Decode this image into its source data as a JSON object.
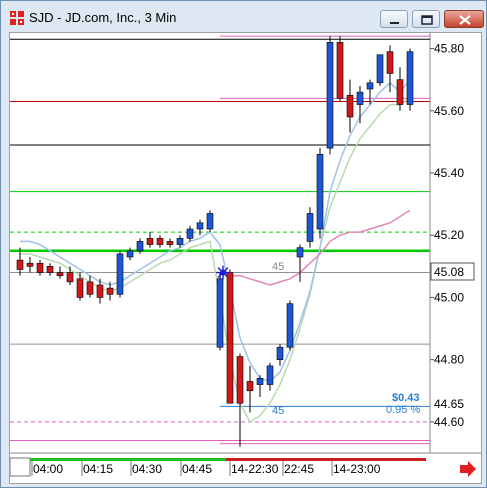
{
  "window": {
    "title": "SJD - JD.com, Inc., 3 Min",
    "app_icon": "grid-app-icon",
    "buttons": [
      "minimize-icon",
      "restore-icon",
      "close-icon"
    ]
  },
  "chart_data": {
    "type": "candlestick",
    "symbol": "SJD",
    "interval": "3 Min",
    "y_ticks": [
      "45.80",
      "45.60",
      "45.40",
      "45.20",
      "45.00",
      "44.80",
      "44.60"
    ],
    "ylim": [
      44.5,
      45.85
    ],
    "x_ticks": [
      "04:00",
      "04:15",
      "04:30",
      "04:45",
      "14-22:30",
      "22:45",
      "14-23:00"
    ],
    "current_price": "45.08",
    "price_tag": "44.65",
    "change_label": "$0.43",
    "change_pct": "0.95 %",
    "line_label_upper": "45",
    "line_label_lower": "45",
    "colors": {
      "up": "#1e57d6",
      "down": "#d01818",
      "ma_fast": "#9ec2ea",
      "ma_slow": "#b9d9b0",
      "ma_pink": "#e487b8",
      "support": "#00cc00",
      "label_blue": "#2a7fd4"
    },
    "candles": [
      {
        "o": 45.12,
        "h": 45.16,
        "l": 45.07,
        "c": 45.09
      },
      {
        "o": 45.11,
        "h": 45.13,
        "l": 45.08,
        "c": 45.1
      },
      {
        "o": 45.11,
        "h": 45.12,
        "l": 45.07,
        "c": 45.08
      },
      {
        "o": 45.1,
        "h": 45.11,
        "l": 45.07,
        "c": 45.08
      },
      {
        "o": 45.08,
        "h": 45.1,
        "l": 45.06,
        "c": 45.07
      },
      {
        "o": 45.08,
        "h": 45.1,
        "l": 45.04,
        "c": 45.05
      },
      {
        "o": 45.06,
        "h": 45.08,
        "l": 44.99,
        "c": 45.0
      },
      {
        "o": 45.05,
        "h": 45.07,
        "l": 45.0,
        "c": 45.01
      },
      {
        "o": 45.04,
        "h": 45.06,
        "l": 44.98,
        "c": 45.0
      },
      {
        "o": 45.03,
        "h": 45.05,
        "l": 44.99,
        "c": 45.01
      },
      {
        "o": 45.01,
        "h": 45.15,
        "l": 45.0,
        "c": 45.14
      },
      {
        "o": 45.13,
        "h": 45.16,
        "l": 45.12,
        "c": 45.15
      },
      {
        "o": 45.15,
        "h": 45.19,
        "l": 45.14,
        "c": 45.18
      },
      {
        "o": 45.19,
        "h": 45.21,
        "l": 45.16,
        "c": 45.17
      },
      {
        "o": 45.19,
        "h": 45.2,
        "l": 45.16,
        "c": 45.17
      },
      {
        "o": 45.18,
        "h": 45.19,
        "l": 45.16,
        "c": 45.17
      },
      {
        "o": 45.17,
        "h": 45.2,
        "l": 45.16,
        "c": 45.19
      },
      {
        "o": 45.19,
        "h": 45.23,
        "l": 45.18,
        "c": 45.22
      },
      {
        "o": 45.22,
        "h": 45.25,
        "l": 45.2,
        "c": 45.24
      },
      {
        "o": 45.22,
        "h": 45.28,
        "l": 45.21,
        "c": 45.27
      },
      {
        "o": 44.84,
        "h": 45.08,
        "l": 44.83,
        "c": 45.06
      },
      {
        "o": 45.08,
        "h": 45.09,
        "l": 44.66,
        "c": 44.66
      },
      {
        "o": 44.81,
        "h": 44.82,
        "l": 44.52,
        "c": 44.66
      },
      {
        "o": 44.73,
        "h": 44.78,
        "l": 44.63,
        "c": 44.7
      },
      {
        "o": 44.72,
        "h": 44.75,
        "l": 44.68,
        "c": 44.74
      },
      {
        "o": 44.72,
        "h": 44.79,
        "l": 44.7,
        "c": 44.78
      },
      {
        "o": 44.8,
        "h": 44.85,
        "l": 44.78,
        "c": 44.84
      },
      {
        "o": 44.84,
        "h": 44.99,
        "l": 44.83,
        "c": 44.98
      },
      {
        "o": 45.13,
        "h": 45.17,
        "l": 45.05,
        "c": 45.16
      },
      {
        "o": 45.18,
        "h": 45.29,
        "l": 45.16,
        "c": 45.27
      },
      {
        "o": 45.22,
        "h": 45.48,
        "l": 45.19,
        "c": 45.46
      },
      {
        "o": 45.48,
        "h": 45.84,
        "l": 45.46,
        "c": 45.82
      },
      {
        "o": 45.82,
        "h": 45.84,
        "l": 45.63,
        "c": 45.64
      },
      {
        "o": 45.65,
        "h": 45.7,
        "l": 45.53,
        "c": 45.58
      },
      {
        "o": 45.62,
        "h": 45.68,
        "l": 45.56,
        "c": 45.66
      },
      {
        "o": 45.67,
        "h": 45.7,
        "l": 45.62,
        "c": 45.69
      },
      {
        "o": 45.69,
        "h": 45.78,
        "l": 45.68,
        "c": 45.78
      },
      {
        "o": 45.79,
        "h": 45.81,
        "l": 45.66,
        "c": 45.72
      },
      {
        "o": 45.7,
        "h": 45.74,
        "l": 45.6,
        "c": 45.62
      },
      {
        "o": 45.62,
        "h": 45.8,
        "l": 45.6,
        "c": 45.79
      }
    ],
    "levels": [
      {
        "y": 45.84,
        "color": "#e060c0",
        "style": "solid",
        "extends_left": false
      },
      {
        "y": 45.83,
        "color": "#000000",
        "style": "solid",
        "extends_left": true
      },
      {
        "y": 45.64,
        "color": "#e060c0",
        "style": "solid",
        "extends_left": false
      },
      {
        "y": 45.63,
        "color": "#c00000",
        "style": "solid",
        "extends_left": true
      },
      {
        "y": 45.49,
        "color": "#000000",
        "style": "solid",
        "extends_left": true
      },
      {
        "y": 45.34,
        "color": "#00cc00",
        "style": "solid",
        "extends_left": true
      },
      {
        "y": 45.21,
        "color": "#00cc00",
        "style": "dashed",
        "extends_left": true
      },
      {
        "y": 45.15,
        "color": "#00cc00",
        "style": "thick",
        "extends_left": true
      },
      {
        "y": 45.08,
        "color": "#909090",
        "style": "solid",
        "extends_left": true
      },
      {
        "y": 44.85,
        "color": "#909090",
        "style": "solid",
        "extends_left": true
      },
      {
        "y": 44.65,
        "color": "#2a7fd4",
        "style": "solid",
        "extends_left": false
      },
      {
        "y": 44.6,
        "color": "#e060c0",
        "style": "dashed",
        "extends_left": true
      },
      {
        "y": 44.54,
        "color": "#e060c0",
        "style": "solid",
        "extends_left": true
      },
      {
        "y": 44.53,
        "color": "#e060c0",
        "style": "solid",
        "extends_left": false
      }
    ],
    "ma_fast": [
      45.18,
      45.18,
      45.17,
      45.15,
      45.13,
      45.11,
      45.09,
      45.07,
      45.05,
      45.04,
      45.05,
      45.07,
      45.09,
      45.11,
      45.13,
      45.15,
      45.16,
      45.18,
      45.19,
      45.21,
      45.17,
      45.03,
      44.87,
      44.79,
      44.74,
      44.73,
      44.76,
      44.83,
      44.92,
      45.02,
      45.16,
      45.34,
      45.44,
      45.52,
      45.58,
      45.62,
      45.66,
      45.69,
      45.66,
      45.7
    ],
    "ma_slow": [
      45.14,
      45.14,
      45.13,
      45.12,
      45.11,
      45.09,
      45.07,
      45.05,
      45.03,
      45.02,
      45.03,
      45.05,
      45.07,
      45.09,
      45.11,
      45.12,
      45.14,
      45.16,
      45.17,
      45.18,
      45.0,
      44.8,
      44.66,
      44.6,
      44.62,
      44.66,
      44.72,
      44.8,
      44.9,
      45.01,
      45.16,
      45.29,
      45.37,
      45.45,
      45.51,
      45.55,
      45.59,
      45.62,
      45.62,
      45.64
    ],
    "ma_pink": [
      null,
      null,
      null,
      null,
      null,
      null,
      null,
      null,
      null,
      null,
      null,
      null,
      null,
      null,
      null,
      null,
      null,
      null,
      null,
      null,
      45.08,
      45.07,
      45.07,
      45.06,
      45.05,
      45.04,
      45.05,
      45.06,
      45.08,
      45.11,
      45.14,
      45.18,
      45.2,
      45.21,
      45.21,
      45.22,
      45.23,
      45.24,
      45.26,
      45.28
    ],
    "marker_index": 20,
    "marker_price": 45.08
  }
}
